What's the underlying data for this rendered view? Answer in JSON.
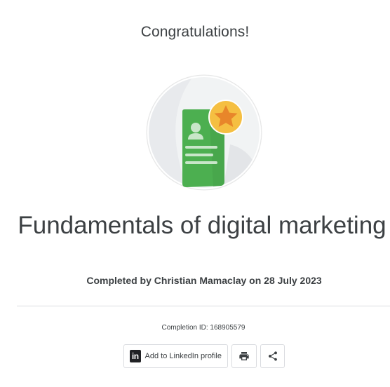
{
  "header": {
    "congrats_text": "Congratulations!"
  },
  "badge": {
    "icon": "certificate-badge-icon",
    "colors": {
      "card": "#4caf50",
      "star_circle": "#f5bf42",
      "star": "#e8862a",
      "background": "#eeeeee"
    }
  },
  "course": {
    "title": "Fundamentals of digital marketing",
    "completed_text": "Completed by Christian Mamaclay on 28 July 2023"
  },
  "completion": {
    "id_text": "Completion ID: 168905579"
  },
  "actions": {
    "linkedin_label": "Add to LinkedIn profile",
    "linkedin_icon": "linkedin-icon",
    "print_icon": "print-icon",
    "share_icon": "share-icon"
  }
}
